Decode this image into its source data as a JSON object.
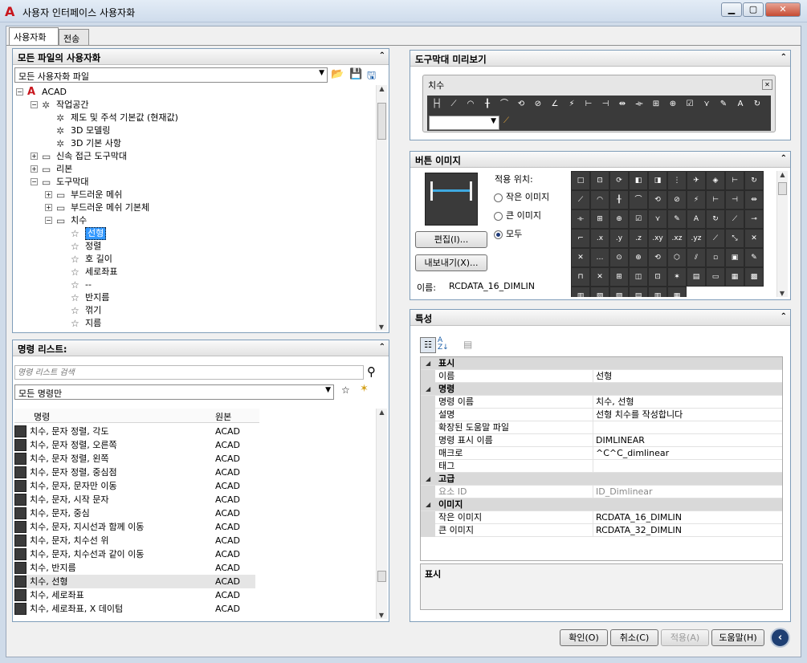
{
  "window": {
    "title": "사용자 인터페이스 사용자화",
    "logo": "A",
    "min": "▁",
    "max": "▢",
    "close": "✕"
  },
  "tabs": [
    "사용자화",
    "전송"
  ],
  "files_panel": {
    "title": "모든 파일의 사용자화",
    "combo_value": "모든 사용자화 파일",
    "tree": [
      {
        "label": "ACAD",
        "icon": "autocad-icon",
        "level": 0,
        "exp": "−"
      },
      {
        "label": "작업공간",
        "icon": "gear-icon",
        "level": 1,
        "exp": "−"
      },
      {
        "label": "제도 및 주석 기본값 (현재값)",
        "icon": "gear-icon",
        "level": 2,
        "exp": ""
      },
      {
        "label": "3D 모델링",
        "icon": "gear-icon",
        "level": 2,
        "exp": ""
      },
      {
        "label": "3D 기본 사항",
        "icon": "gear-icon",
        "level": 2,
        "exp": ""
      },
      {
        "label": "신속 접근 도구막대",
        "icon": "toolbar-icon",
        "level": 1,
        "exp": "+"
      },
      {
        "label": "리본",
        "icon": "ribbon-icon",
        "level": 1,
        "exp": "+"
      },
      {
        "label": "도구막대",
        "icon": "toolbar-icon",
        "level": 1,
        "exp": "−"
      },
      {
        "label": "부드러운 메쉬",
        "icon": "toolbar-icon",
        "level": 2,
        "exp": "+"
      },
      {
        "label": "부드러운 메쉬 기본체",
        "icon": "toolbar-icon",
        "level": 2,
        "exp": "+"
      },
      {
        "label": "치수",
        "icon": "toolbar-icon",
        "level": 2,
        "exp": "−"
      },
      {
        "label": "선형",
        "icon": "star-icon",
        "level": 3,
        "exp": "",
        "selected": true
      },
      {
        "label": "정렬",
        "icon": "star-icon",
        "level": 3,
        "exp": ""
      },
      {
        "label": "호 길이",
        "icon": "star-icon",
        "level": 3,
        "exp": ""
      },
      {
        "label": "세로좌표",
        "icon": "star-icon",
        "level": 3,
        "exp": ""
      },
      {
        "label": "--",
        "icon": "star-icon",
        "level": 3,
        "exp": ""
      },
      {
        "label": "반지름",
        "icon": "star-icon",
        "level": 3,
        "exp": ""
      },
      {
        "label": "꺾기",
        "icon": "star-icon",
        "level": 3,
        "exp": ""
      },
      {
        "label": "지름",
        "icon": "star-icon",
        "level": 3,
        "exp": ""
      }
    ]
  },
  "command_panel": {
    "title": "명령 리스트:",
    "search_placeholder": "명령 리스트 검색",
    "filter_value": "모든 명령만",
    "col_command": "명령",
    "col_source": "원본",
    "rows": [
      {
        "name": "치수, 문자 정렬, 각도",
        "source": "ACAD"
      },
      {
        "name": "치수, 문자 정렬, 오른쪽",
        "source": "ACAD"
      },
      {
        "name": "치수, 문자 정렬, 왼쪽",
        "source": "ACAD"
      },
      {
        "name": "치수, 문자 정렬, 중심점",
        "source": "ACAD"
      },
      {
        "name": "치수, 문자, 문자만 이동",
        "source": "ACAD"
      },
      {
        "name": "치수, 문자, 시작 문자",
        "source": "ACAD"
      },
      {
        "name": "치수, 문자, 중심",
        "source": "ACAD"
      },
      {
        "name": "치수, 문자, 지시선과 함께 이동",
        "source": "ACAD"
      },
      {
        "name": "치수, 문자, 치수선 위",
        "source": "ACAD"
      },
      {
        "name": "치수, 문자, 치수선과 같이 이동",
        "source": "ACAD"
      },
      {
        "name": "치수, 반지름",
        "source": "ACAD"
      },
      {
        "name": "치수, 선형",
        "source": "ACAD",
        "selected": true
      },
      {
        "name": "치수, 세로좌표",
        "source": "ACAD"
      },
      {
        "name": "치수, 세로좌표, X 데이텀",
        "source": "ACAD"
      }
    ]
  },
  "preview_panel": {
    "title": "도구막대 미리보기",
    "toolbar_title": "치수",
    "close": "✕",
    "icons": [
      "linear-dim-icon",
      "aligned-dim-icon",
      "arc-length-icon",
      "ordinate-dim-icon",
      "radius-dim-icon",
      "jogged-dim-icon",
      "diameter-dim-icon",
      "angular-dim-icon",
      "quick-dim-icon",
      "baseline-dim-icon",
      "continue-dim-icon",
      "dim-space-icon",
      "dim-break-icon",
      "tolerance-icon",
      "center-mark-icon",
      "inspect-icon",
      "jogged-linear-icon",
      "dimedit-icon",
      "dimtedit-icon",
      "dim-update-icon"
    ],
    "glyphs": [
      "├┤",
      "⟋",
      "◠",
      "╂",
      "⌒",
      "⟲",
      "⊘",
      "∠",
      "⚡",
      "⊢",
      "⊣",
      "⇹",
      "⟛",
      "⊞",
      "⊕",
      "☑",
      "⋎",
      "✎",
      "A",
      "↻"
    ]
  },
  "button_image_panel": {
    "title": "버튼 이미지",
    "apply_label": "적용 위치:",
    "options": [
      "작은 이미지",
      "큰 이미지",
      "모두"
    ],
    "selected_option": 2,
    "edit_button": "편집(I)...",
    "export_button": "내보내기(X)...",
    "name_label": "이름:",
    "name_value": "RCDATA_16_DIMLIN",
    "grid_glyphs": [
      "□",
      "⊡",
      "⟳",
      "◧",
      "◨",
      "⋮",
      "✈",
      "◈",
      "⊢",
      "↻",
      "⟋",
      "◠",
      "╂",
      "⌒",
      "⟲",
      "⊘",
      "⚡",
      "⊢",
      "⊣",
      "⇹",
      "⟛",
      "⊞",
      "⊕",
      "☑",
      "⋎",
      "✎",
      "A",
      "↻",
      "⟋",
      "⊸",
      "⌐",
      ".x",
      ".y",
      ".z",
      ".xy",
      ".xz",
      ".yz",
      "⟋",
      "⤡",
      "✕",
      "✕",
      "…",
      "⊙",
      "⊕",
      "⟲",
      "⬡",
      "⫽",
      "▫",
      "▣",
      "✎",
      "⊓",
      "✕",
      "⊞",
      "◫",
      "⊡",
      "✶",
      "▤",
      "▭",
      "▦",
      "▩",
      "▥",
      "▧",
      "▨",
      "▤",
      "▥",
      "▦"
    ]
  },
  "properties_panel": {
    "title": "특성",
    "rows": [
      {
        "type": "cat",
        "label": "표시"
      },
      {
        "type": "prop",
        "label": "이름",
        "value": "선형"
      },
      {
        "type": "cat",
        "label": "명령"
      },
      {
        "type": "prop",
        "label": "명령 이름",
        "value": "치수, 선형"
      },
      {
        "type": "prop",
        "label": "설명",
        "value": "선형 치수를 작성합니다"
      },
      {
        "type": "prop",
        "label": "확장된 도움말 파일",
        "value": ""
      },
      {
        "type": "prop",
        "label": "명령 표시 이름",
        "value": "DIMLINEAR"
      },
      {
        "type": "prop",
        "label": "매크로",
        "value": "^C^C_dimlinear"
      },
      {
        "type": "prop",
        "label": "태그",
        "value": ""
      },
      {
        "type": "cat",
        "label": "고급"
      },
      {
        "type": "prop",
        "label": "요소 ID",
        "value": "ID_Dimlinear",
        "gray": true
      },
      {
        "type": "cat",
        "label": "이미지"
      },
      {
        "type": "prop",
        "label": "작은 이미지",
        "value": "RCDATA_16_DIMLIN"
      },
      {
        "type": "prop",
        "label": "큰 이미지",
        "value": "RCDATA_32_DIMLIN"
      }
    ],
    "description_title": "표시"
  },
  "buttons": {
    "ok": "확인(O)",
    "cancel": "취소(C)",
    "apply": "적용(A)",
    "help": "도움말(H)"
  }
}
